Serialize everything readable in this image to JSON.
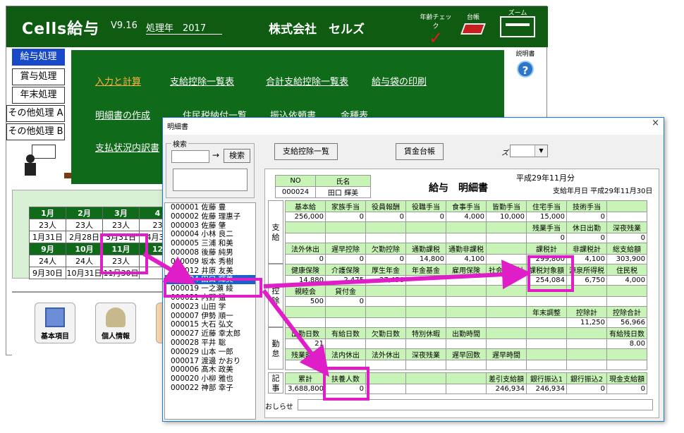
{
  "main": {
    "app_name": "Cells給与",
    "version": "V9.16",
    "year_label": "処理年　2017",
    "company": "株式会社　セルズ",
    "toolbar": [
      {
        "label": "年齢チェック",
        "icon": "check-icon"
      },
      {
        "label": "台帳",
        "icon": "ledger-book-icon"
      },
      {
        "label": "ズーム",
        "icon": "zoom-icon"
      }
    ],
    "side_tabs": [
      "給与処理",
      "賞与処理",
      "年末処理",
      "その他処理 A",
      "その他処理 B"
    ],
    "menu": [
      [
        "入力と計算",
        "支給控除一覧表",
        "合計支給控除一覧表",
        "給与袋の印刷"
      ],
      [
        "明細書の作成",
        "住民税納付一覧",
        "振込依頼書",
        "金種表"
      ],
      [
        "支払状況内訳書"
      ]
    ],
    "help_label": "説明書",
    "calendar": {
      "rows": [
        [
          "1月",
          "2月",
          "3月",
          "4"
        ],
        [
          "23人",
          "23人",
          "23人",
          "23"
        ],
        [
          "1月31日",
          "2月28日",
          "3月31日",
          "4月30"
        ],
        [
          "9月",
          "10月",
          "11月",
          "12"
        ],
        [
          "24人",
          "24人",
          "23人",
          ""
        ],
        [
          "9月30日",
          "10月31日",
          "11月30日",
          ""
        ]
      ]
    },
    "bottom_icons": [
      "基本項目",
      "個人情報"
    ]
  },
  "dialog": {
    "title": "明細書",
    "close": "×",
    "search_group": "検索",
    "search_button": "検索",
    "search_value": "",
    "btn_list": "支給控除一覧",
    "btn_ledger": "賃金台帳",
    "zoom_label": "ズーム",
    "zoom_value": "",
    "employees": [
      "000001 佐藤 豊",
      "000002 佐藤 理惠子",
      "000003 佐藤 肇",
      "000004 小林 良二",
      "000005 三浦 和美",
      "000008 後藤 純男",
      "000009 坂本 秀樹",
      "000012 井原 友美",
      "000024 田口 輝美",
      "000019 一之瀬 綾",
      "000021 内野 猛",
      "000023 山田 学",
      "000007 伊勢 順一",
      "000015 大石 弘文",
      "000027 近藤 幸太郎",
      "000028 平井 聡",
      "000029 山本 一郎",
      "000017 渡邊 かおり",
      "000006 髙木 政美",
      "000020 小柳 雅也",
      "000022 神部 幸子"
    ],
    "selected_index": 8,
    "slip": {
      "no_label": "NO",
      "name_label": "氏名",
      "no": "000024",
      "name": "田口 輝美",
      "title": "給与　明細書",
      "period": "平成29年11月分",
      "pay_date": "支給年月日 平成29年11月30日",
      "shikyu_label": "支\n給",
      "kojo_label": "控\n除",
      "kintai_label": "勤\n怠",
      "kiji_label": "記\n事",
      "pay_h1": [
        "基本給",
        "家族手当",
        "役員報酬",
        "役職手当",
        "食事手当",
        "皆勤手当",
        "住宅手当",
        "技術手当",
        ""
      ],
      "pay_v1": [
        "256,000",
        "0",
        "0",
        "0",
        "4,000",
        "10,000",
        "15,000",
        "0",
        ""
      ],
      "pay_h2": [
        "",
        "",
        "",
        "",
        "",
        "",
        "残業手当",
        "休日出勤",
        "深夜残業"
      ],
      "pay_v2": [
        "",
        "",
        "",
        "",
        "",
        "",
        "0",
        "0",
        "0"
      ],
      "pay_h3": [
        "法外休出",
        "遅早控除",
        "欠勤控除",
        "通勤課税",
        "通勤非課税",
        "",
        "課税計",
        "非課税計",
        "総支給額"
      ],
      "pay_v3": [
        "0",
        "0",
        "0",
        "14,800",
        "4,100",
        "",
        "299,800",
        "4,100",
        "303,900"
      ],
      "ded_h1": [
        "健康保険",
        "介護保険",
        "厚生年金",
        "年金基金",
        "雇用保険",
        "社会保険計",
        "課税対象額",
        "源泉所得税",
        "住民税"
      ],
      "ded_v1": [
        "14,880",
        "2,475",
        "27,450",
        "",
        "",
        "",
        "254,084",
        "6,750",
        "4,000"
      ],
      "ded_h2": [
        "親睦会",
        "貸付金",
        "",
        "",
        "",
        "",
        "",
        "",
        ""
      ],
      "ded_v2": [
        "500",
        "0",
        "",
        "",
        "",
        "",
        "",
        "",
        ""
      ],
      "ded_h3": [
        "",
        "",
        "",
        "",
        "",
        "",
        "年末調整",
        "控除計",
        "控除合計"
      ],
      "ded_v3": [
        "",
        "",
        "",
        "",
        "",
        "",
        "",
        "11,250",
        "56,966"
      ],
      "att_h1": [
        "出勤日数",
        "有給日数",
        "欠勤日数",
        "特別休暇",
        "出勤時間",
        "",
        "",
        "",
        "有給残日数"
      ],
      "att_v1": [
        "21",
        "",
        "",
        "",
        "",
        "",
        "",
        "",
        "8.00"
      ],
      "att_h2": [
        "残業時間",
        "法内休出",
        "法外休出",
        "深夜残業",
        "遅早回数",
        "遅早時間",
        "",
        "",
        ""
      ],
      "att_v2": [
        "",
        "",
        "",
        "",
        "",
        "",
        "",
        "",
        ""
      ],
      "memo_h": [
        "累計",
        "扶養人数",
        "",
        "",
        "",
        "差引支給額",
        "銀行振込1",
        "銀行振込2",
        "現金支給額"
      ],
      "memo_v": [
        "3,688,800",
        "0",
        "",
        "",
        "",
        "246,934",
        "246,934",
        "0",
        "0"
      ],
      "notice_label": "おしらせ",
      "notice": ""
    }
  }
}
